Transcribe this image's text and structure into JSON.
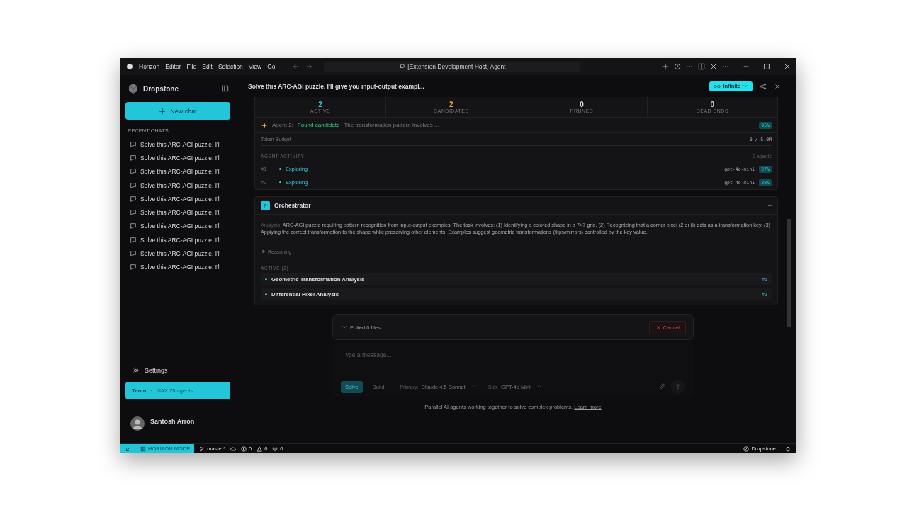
{
  "menu": [
    "Horizon",
    "Editor",
    "File",
    "Edit",
    "Selection",
    "View",
    "Go",
    "···"
  ],
  "command_center": "[Extension Development Host] Agent",
  "sidebar": {
    "brand": "Dropstone",
    "new_chat": "New chat",
    "section": "RECENT CHATS",
    "chats": [
      "Solve this ARC-AGI puzzle. I'l",
      "Solve this ARC-AGI puzzle. I'l",
      "Solve this ARC-AGI puzzle. I'l",
      "Solve this ARC-AGI puzzle. I'l",
      "Solve this ARC-AGI puzzle. I'l",
      "Solve this ARC-AGI puzzle. I'l",
      "Solve this ARC-AGI puzzle. I'l",
      "Solve this ARC-AGI puzzle. I'l",
      "Solve this ARC-AGI puzzle. I'l",
      "Solve this ARC-AGI puzzle. I'l"
    ],
    "settings": "Settings",
    "plan": {
      "name": "Team",
      "separator": "·",
      "detail": "MAX 25 agents"
    },
    "user": "Santosh Arron"
  },
  "header": {
    "title": "Solve this ARC-AGI puzzle. I'll give you input-output exampl...",
    "mode": "Infinite"
  },
  "stats": [
    {
      "value": "2",
      "label": "ACTIVE",
      "color": "#3ec6d6"
    },
    {
      "value": "2",
      "label": "CANDIDATES",
      "color": "#e8a53c"
    },
    {
      "value": "0",
      "label": "PRUNED",
      "color": "#d8d8d8"
    },
    {
      "value": "0",
      "label": "DEAD ENDS",
      "color": "#d8d8d8"
    }
  ],
  "event": {
    "agent": "Agent 2:",
    "status": "Found candidate",
    "text": "The transformation pattern involves ...",
    "score": "95%"
  },
  "token_budget": {
    "label": "Token Budget",
    "reading": "0 / 5.0M"
  },
  "activity": {
    "title": "AGENT ACTIVITY",
    "count": "2 agents",
    "agents": [
      {
        "id": "#1",
        "status": "Exploring",
        "model": "gpt-4o-mini",
        "progress": "27%"
      },
      {
        "id": "#2",
        "status": "Exploring",
        "model": "gpt-4o-mini",
        "progress": "28%"
      }
    ]
  },
  "orchestrator": {
    "badge": "P",
    "title": "Orchestrator",
    "expanded": true,
    "analysis_label": "Analysis:",
    "analysis": "ARC-AGI puzzle requiring pattern recognition from input-output examples. The task involves: (1) Identifying a colored shape in a 7×7 grid, (2) Recognizing that a corner pixel (2 or 8) acts as a transformation key, (3) Applying the correct transformation to the shape while preserving other elements. Examples suggest geometric transformations (flips/mirrors) controlled by the key value.",
    "reasoning": "Reasoning",
    "active_title": "ACTIVE (2)",
    "tasks": [
      {
        "name": "Geometric Transformation Analysis",
        "ref": "#1"
      },
      {
        "name": "Differential Pixel Analysis",
        "ref": "#2"
      }
    ]
  },
  "composer": {
    "edited": "Edited 0 files",
    "cancel": "Cancel",
    "placeholder": "Type a message...",
    "modes": [
      {
        "label": "Solve",
        "selected": true
      },
      {
        "label": "Build",
        "selected": false
      }
    ],
    "primary_label": "Primary:",
    "primary": "Claude 4.5 Sonnet",
    "sub_label": "Sub:",
    "sub": "GPT-4o Mini"
  },
  "footer": {
    "text": "Parallel AI agents working together to solve complex problems.",
    "link": "Learn more"
  },
  "status_bar": {
    "mode": "HORIZON MODE",
    "branch": "master*",
    "errors": "0",
    "warnings": "0",
    "ports": "0",
    "product": "Dropstone"
  }
}
